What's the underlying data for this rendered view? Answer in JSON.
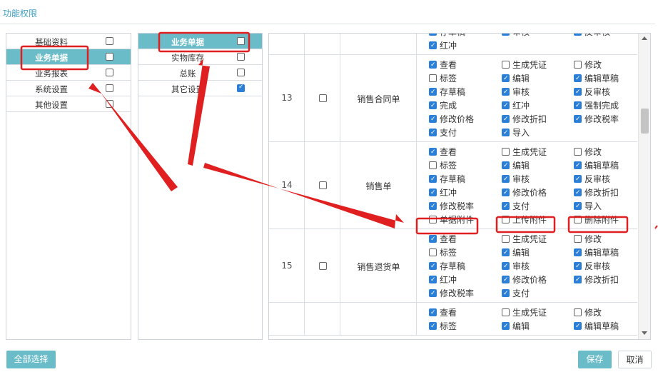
{
  "tab_title": "功能权限",
  "panel1": [
    {
      "label": "基础资料",
      "checked": false,
      "selected": false
    },
    {
      "label": "业务单据",
      "checked": false,
      "selected": true
    },
    {
      "label": "业务报表",
      "checked": false,
      "selected": false
    },
    {
      "label": "系统设置",
      "checked": false,
      "selected": false
    },
    {
      "label": "其他设置",
      "checked": false,
      "selected": false
    }
  ],
  "panel2": [
    {
      "label": "业务单据",
      "checked": false,
      "selected": true
    },
    {
      "label": "实物库存",
      "checked": false,
      "selected": false
    },
    {
      "label": "总账",
      "checked": false,
      "selected": false
    },
    {
      "label": "其它设置",
      "checked": true,
      "selected": false
    }
  ],
  "rows": [
    {
      "num": "",
      "name": "",
      "perms": [
        {
          "label": "存草稿",
          "checked": true
        },
        {
          "label": "审核",
          "checked": true
        },
        {
          "label": "反审核",
          "checked": true
        },
        {
          "label": "红冲",
          "checked": true
        }
      ]
    },
    {
      "num": "13",
      "name": "销售合同单",
      "perms": [
        {
          "label": "查看",
          "checked": true
        },
        {
          "label": "生成凭证",
          "checked": false
        },
        {
          "label": "修改",
          "checked": false
        },
        {
          "label": "标签",
          "checked": false
        },
        {
          "label": "编辑",
          "checked": true
        },
        {
          "label": "编辑草稿",
          "checked": true
        },
        {
          "label": "存草稿",
          "checked": true
        },
        {
          "label": "审核",
          "checked": true
        },
        {
          "label": "反审核",
          "checked": true
        },
        {
          "label": "完成",
          "checked": true
        },
        {
          "label": "红冲",
          "checked": true
        },
        {
          "label": "强制完成",
          "checked": true
        },
        {
          "label": "修改价格",
          "checked": true
        },
        {
          "label": "修改折扣",
          "checked": true
        },
        {
          "label": "修改税率",
          "checked": true
        },
        {
          "label": "支付",
          "checked": true
        },
        {
          "label": "导入",
          "checked": true
        }
      ]
    },
    {
      "num": "14",
      "name": "销售单",
      "perms": [
        {
          "label": "查看",
          "checked": true
        },
        {
          "label": "生成凭证",
          "checked": false
        },
        {
          "label": "修改",
          "checked": false
        },
        {
          "label": "标签",
          "checked": false
        },
        {
          "label": "编辑",
          "checked": true
        },
        {
          "label": "编辑草稿",
          "checked": true
        },
        {
          "label": "存草稿",
          "checked": true
        },
        {
          "label": "审核",
          "checked": true
        },
        {
          "label": "反审核",
          "checked": true
        },
        {
          "label": "红冲",
          "checked": true
        },
        {
          "label": "修改价格",
          "checked": true
        },
        {
          "label": "修改折扣",
          "checked": true
        },
        {
          "label": "修改税率",
          "checked": true
        },
        {
          "label": "支付",
          "checked": true
        },
        {
          "label": "导入",
          "checked": true
        },
        {
          "label": "单据附件",
          "checked": false
        },
        {
          "label": "上传附件",
          "checked": false
        },
        {
          "label": "删除附件",
          "checked": false
        }
      ]
    },
    {
      "num": "15",
      "name": "销售退货单",
      "perms": [
        {
          "label": "查看",
          "checked": true
        },
        {
          "label": "生成凭证",
          "checked": false
        },
        {
          "label": "修改",
          "checked": false
        },
        {
          "label": "标签",
          "checked": false
        },
        {
          "label": "编辑",
          "checked": true
        },
        {
          "label": "编辑草稿",
          "checked": true
        },
        {
          "label": "存草稿",
          "checked": true
        },
        {
          "label": "审核",
          "checked": true
        },
        {
          "label": "反审核",
          "checked": true
        },
        {
          "label": "红冲",
          "checked": true
        },
        {
          "label": "修改价格",
          "checked": true
        },
        {
          "label": "修改折扣",
          "checked": true
        },
        {
          "label": "修改税率",
          "checked": true
        },
        {
          "label": "支付",
          "checked": true
        }
      ]
    },
    {
      "num": "",
      "name": "",
      "perms": [
        {
          "label": "查看",
          "checked": true
        },
        {
          "label": "生成凭证",
          "checked": false
        },
        {
          "label": "修改",
          "checked": false
        },
        {
          "label": "标签",
          "checked": true
        },
        {
          "label": "编辑",
          "checked": true
        },
        {
          "label": "编辑草稿",
          "checked": true
        }
      ]
    }
  ],
  "buttons": {
    "select_all": "全部选择",
    "save": "保存",
    "cancel": "取消"
  },
  "colors": {
    "accent": "#6bbcc9",
    "checkbox": "#2b7fd6",
    "annotation": "#e02020"
  }
}
